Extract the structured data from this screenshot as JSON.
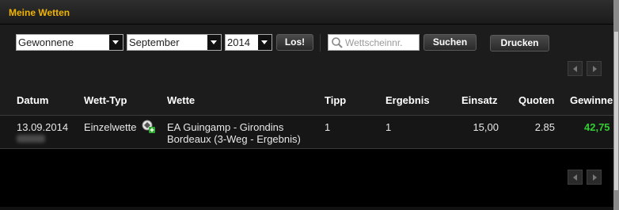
{
  "panel": {
    "title": "Meine Wetten"
  },
  "filters": {
    "status": "Gewonnene",
    "month": "September",
    "year": "2014",
    "go_label": "Los!"
  },
  "search": {
    "placeholder": "Wettscheinnr.",
    "button_label": "Suchen"
  },
  "print_label": "Drucken",
  "table": {
    "headers": [
      "Datum",
      "Wett-Typ",
      "Wette",
      "Tipp",
      "Ergebnis",
      "Einsatz",
      "Quoten",
      "Gewinne"
    ],
    "rows": [
      {
        "datum": "13.09.2014",
        "typ": "Einzelwette",
        "wette_line1": "EA Guingamp - Girondins",
        "wette_line2": "Bordeaux (3-Weg - Ergebnis)",
        "tipp": "1",
        "ergebnis": "1",
        "einsatz": "15,00",
        "quoten": "2.85",
        "gewinne": "42,75"
      }
    ]
  },
  "colors": {
    "title": "#f0b400",
    "win": "#33cc33"
  }
}
